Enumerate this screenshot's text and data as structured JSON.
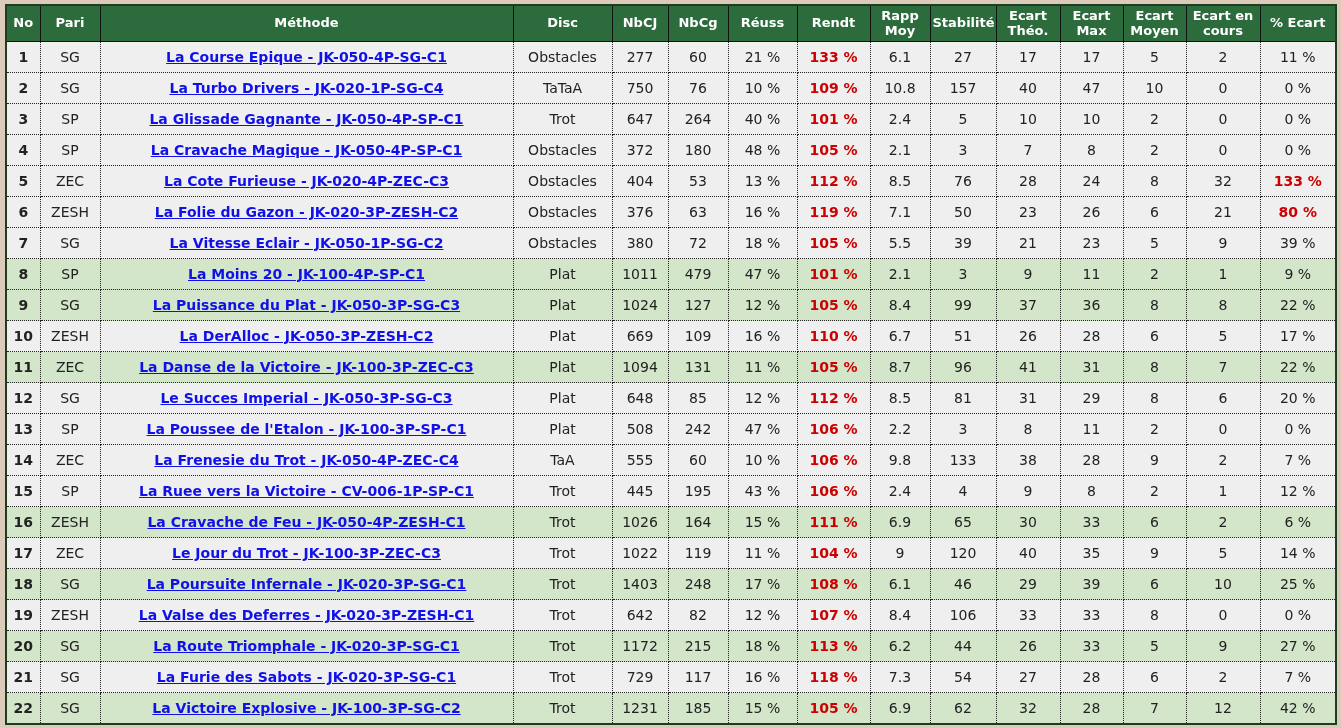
{
  "table": {
    "columns": [
      "No",
      "Pari",
      "Méthode",
      "Disc",
      "NbCJ",
      "NbCg",
      "Réuss",
      "Rendt",
      "Rapp Moy",
      "Stabilité",
      "Ecart Théo.",
      "Ecart Max",
      "Ecart Moyen",
      "Ecart en cours",
      "% Ecart"
    ],
    "rows": [
      {
        "no": "1",
        "pari": "SG",
        "methode": "La Course Epique - JK-050-4P-SG-C1",
        "disc": "Obstacles",
        "nbcj": "277",
        "nbcg": "60",
        "reuss": "21 %",
        "rendt": "133 %",
        "rapp": "6.1",
        "stab": "27",
        "theo": "17",
        "max": "17",
        "moyen": "5",
        "encours": "2",
        "pct": "11 %",
        "highlighted": false,
        "alert": false
      },
      {
        "no": "2",
        "pari": "SG",
        "methode": "La Turbo Drivers - JK-020-1P-SG-C4",
        "disc": "TaTaA",
        "nbcj": "750",
        "nbcg": "76",
        "reuss": "10 %",
        "rendt": "109 %",
        "rapp": "10.8",
        "stab": "157",
        "theo": "40",
        "max": "47",
        "moyen": "10",
        "encours": "0",
        "pct": "0 %",
        "highlighted": false,
        "alert": false
      },
      {
        "no": "3",
        "pari": "SP",
        "methode": "La Glissade Gagnante - JK-050-4P-SP-C1",
        "disc": "Trot",
        "nbcj": "647",
        "nbcg": "264",
        "reuss": "40 %",
        "rendt": "101 %",
        "rapp": "2.4",
        "stab": "5",
        "theo": "10",
        "max": "10",
        "moyen": "2",
        "encours": "0",
        "pct": "0 %",
        "highlighted": false,
        "alert": false
      },
      {
        "no": "4",
        "pari": "SP",
        "methode": "La Cravache Magique - JK-050-4P-SP-C1",
        "disc": "Obstacles",
        "nbcj": "372",
        "nbcg": "180",
        "reuss": "48 %",
        "rendt": "105 %",
        "rapp": "2.1",
        "stab": "3",
        "theo": "7",
        "max": "8",
        "moyen": "2",
        "encours": "0",
        "pct": "0 %",
        "highlighted": false,
        "alert": false
      },
      {
        "no": "5",
        "pari": "ZEC",
        "methode": "La Cote Furieuse - JK-020-4P-ZEC-C3",
        "disc": "Obstacles",
        "nbcj": "404",
        "nbcg": "53",
        "reuss": "13 %",
        "rendt": "112 %",
        "rapp": "8.5",
        "stab": "76",
        "theo": "28",
        "max": "24",
        "moyen": "8",
        "encours": "32",
        "pct": "133 %",
        "highlighted": false,
        "alert": true
      },
      {
        "no": "6",
        "pari": "ZESH",
        "methode": "La Folie du Gazon - JK-020-3P-ZESH-C2",
        "disc": "Obstacles",
        "nbcj": "376",
        "nbcg": "63",
        "reuss": "16 %",
        "rendt": "119 %",
        "rapp": "7.1",
        "stab": "50",
        "theo": "23",
        "max": "26",
        "moyen": "6",
        "encours": "21",
        "pct": "80 %",
        "highlighted": false,
        "alert": true
      },
      {
        "no": "7",
        "pari": "SG",
        "methode": "La Vitesse Eclair - JK-050-1P-SG-C2",
        "disc": "Obstacles",
        "nbcj": "380",
        "nbcg": "72",
        "reuss": "18 %",
        "rendt": "105 %",
        "rapp": "5.5",
        "stab": "39",
        "theo": "21",
        "max": "23",
        "moyen": "5",
        "encours": "9",
        "pct": "39 %",
        "highlighted": false,
        "alert": false
      },
      {
        "no": "8",
        "pari": "SP",
        "methode": "La Moins 20 - JK-100-4P-SP-C1",
        "disc": "Plat",
        "nbcj": "1011",
        "nbcg": "479",
        "reuss": "47 %",
        "rendt": "101 %",
        "rapp": "2.1",
        "stab": "3",
        "theo": "9",
        "max": "11",
        "moyen": "2",
        "encours": "1",
        "pct": "9 %",
        "highlighted": true,
        "alert": false
      },
      {
        "no": "9",
        "pari": "SG",
        "methode": "La Puissance du Plat - JK-050-3P-SG-C3",
        "disc": "Plat",
        "nbcj": "1024",
        "nbcg": "127",
        "reuss": "12 %",
        "rendt": "105 %",
        "rapp": "8.4",
        "stab": "99",
        "theo": "37",
        "max": "36",
        "moyen": "8",
        "encours": "8",
        "pct": "22 %",
        "highlighted": true,
        "alert": false
      },
      {
        "no": "10",
        "pari": "ZESH",
        "methode": "La DerAlloc - JK-050-3P-ZESH-C2",
        "disc": "Plat",
        "nbcj": "669",
        "nbcg": "109",
        "reuss": "16 %",
        "rendt": "110 %",
        "rapp": "6.7",
        "stab": "51",
        "theo": "26",
        "max": "28",
        "moyen": "6",
        "encours": "5",
        "pct": "17 %",
        "highlighted": false,
        "alert": false
      },
      {
        "no": "11",
        "pari": "ZEC",
        "methode": "La Danse de la Victoire - JK-100-3P-ZEC-C3",
        "disc": "Plat",
        "nbcj": "1094",
        "nbcg": "131",
        "reuss": "11 %",
        "rendt": "105 %",
        "rapp": "8.7",
        "stab": "96",
        "theo": "41",
        "max": "31",
        "moyen": "8",
        "encours": "7",
        "pct": "22 %",
        "highlighted": true,
        "alert": false
      },
      {
        "no": "12",
        "pari": "SG",
        "methode": "Le Succes Imperial - JK-050-3P-SG-C3",
        "disc": "Plat",
        "nbcj": "648",
        "nbcg": "85",
        "reuss": "12 %",
        "rendt": "112 %",
        "rapp": "8.5",
        "stab": "81",
        "theo": "31",
        "max": "29",
        "moyen": "8",
        "encours": "6",
        "pct": "20 %",
        "highlighted": false,
        "alert": false
      },
      {
        "no": "13",
        "pari": "SP",
        "methode": "La Poussee de l'Etalon - JK-100-3P-SP-C1",
        "disc": "Plat",
        "nbcj": "508",
        "nbcg": "242",
        "reuss": "47 %",
        "rendt": "106 %",
        "rapp": "2.2",
        "stab": "3",
        "theo": "8",
        "max": "11",
        "moyen": "2",
        "encours": "0",
        "pct": "0 %",
        "highlighted": false,
        "alert": false
      },
      {
        "no": "14",
        "pari": "ZEC",
        "methode": "La Frenesie du Trot - JK-050-4P-ZEC-C4",
        "disc": "TaA",
        "nbcj": "555",
        "nbcg": "60",
        "reuss": "10 %",
        "rendt": "106 %",
        "rapp": "9.8",
        "stab": "133",
        "theo": "38",
        "max": "28",
        "moyen": "9",
        "encours": "2",
        "pct": "7 %",
        "highlighted": false,
        "alert": false
      },
      {
        "no": "15",
        "pari": "SP",
        "methode": "La Ruee vers la Victoire - CV-006-1P-SP-C1",
        "disc": "Trot",
        "nbcj": "445",
        "nbcg": "195",
        "reuss": "43 %",
        "rendt": "106 %",
        "rapp": "2.4",
        "stab": "4",
        "theo": "9",
        "max": "8",
        "moyen": "2",
        "encours": "1",
        "pct": "12 %",
        "highlighted": false,
        "alert": false
      },
      {
        "no": "16",
        "pari": "ZESH",
        "methode": "La Cravache de Feu - JK-050-4P-ZESH-C1",
        "disc": "Trot",
        "nbcj": "1026",
        "nbcg": "164",
        "reuss": "15 %",
        "rendt": "111 %",
        "rapp": "6.9",
        "stab": "65",
        "theo": "30",
        "max": "33",
        "moyen": "6",
        "encours": "2",
        "pct": "6 %",
        "highlighted": true,
        "alert": false
      },
      {
        "no": "17",
        "pari": "ZEC",
        "methode": "Le Jour du Trot - JK-100-3P-ZEC-C3",
        "disc": "Trot",
        "nbcj": "1022",
        "nbcg": "119",
        "reuss": "11 %",
        "rendt": "104 %",
        "rapp": "9",
        "stab": "120",
        "theo": "40",
        "max": "35",
        "moyen": "9",
        "encours": "5",
        "pct": "14 %",
        "highlighted": false,
        "alert": false
      },
      {
        "no": "18",
        "pari": "SG",
        "methode": "La Poursuite Infernale - JK-020-3P-SG-C1",
        "disc": "Trot",
        "nbcj": "1403",
        "nbcg": "248",
        "reuss": "17 %",
        "rendt": "108 %",
        "rapp": "6.1",
        "stab": "46",
        "theo": "29",
        "max": "39",
        "moyen": "6",
        "encours": "10",
        "pct": "25 %",
        "highlighted": true,
        "alert": false
      },
      {
        "no": "19",
        "pari": "ZESH",
        "methode": "La Valse des Deferres - JK-020-3P-ZESH-C1",
        "disc": "Trot",
        "nbcj": "642",
        "nbcg": "82",
        "reuss": "12 %",
        "rendt": "107 %",
        "rapp": "8.4",
        "stab": "106",
        "theo": "33",
        "max": "33",
        "moyen": "8",
        "encours": "0",
        "pct": "0 %",
        "highlighted": false,
        "alert": false
      },
      {
        "no": "20",
        "pari": "SG",
        "methode": "La Route Triomphale - JK-020-3P-SG-C1",
        "disc": "Trot",
        "nbcj": "1172",
        "nbcg": "215",
        "reuss": "18 %",
        "rendt": "113 %",
        "rapp": "6.2",
        "stab": "44",
        "theo": "26",
        "max": "33",
        "moyen": "5",
        "encours": "9",
        "pct": "27 %",
        "highlighted": true,
        "alert": false
      },
      {
        "no": "21",
        "pari": "SG",
        "methode": "La Furie des Sabots - JK-020-3P-SG-C1",
        "disc": "Trot",
        "nbcj": "729",
        "nbcg": "117",
        "reuss": "16 %",
        "rendt": "118 %",
        "rapp": "7.3",
        "stab": "54",
        "theo": "27",
        "max": "28",
        "moyen": "6",
        "encours": "2",
        "pct": "7 %",
        "highlighted": false,
        "alert": false
      },
      {
        "no": "22",
        "pari": "SG",
        "methode": "La Victoire Explosive - JK-100-3P-SG-C2",
        "disc": "Trot",
        "nbcj": "1231",
        "nbcg": "185",
        "reuss": "15 %",
        "rendt": "105 %",
        "rapp": "6.9",
        "stab": "62",
        "theo": "32",
        "max": "28",
        "moyen": "7",
        "encours": "12",
        "pct": "42 %",
        "highlighted": true,
        "alert": false
      }
    ]
  }
}
